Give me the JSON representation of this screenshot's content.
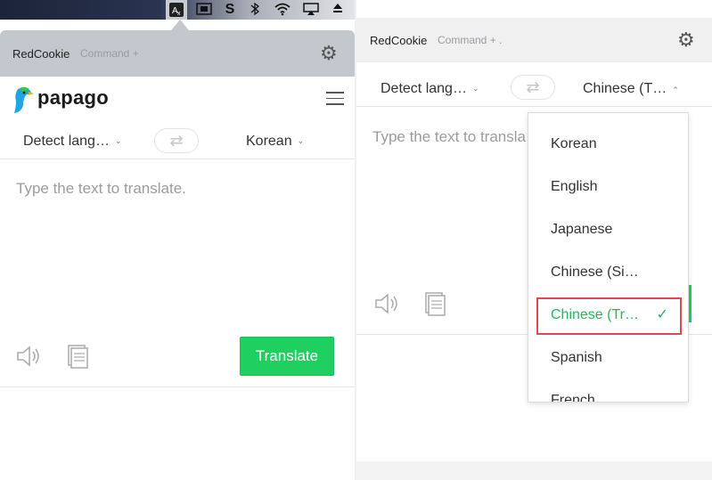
{
  "menubar": {
    "icons": [
      "translate-icon",
      "screenshot-icon",
      "s-app-icon",
      "bluetooth-icon",
      "wifi-icon",
      "airplay-icon",
      "eject-icon"
    ]
  },
  "left_panel": {
    "brand": "RedCookie",
    "shortcut": "Command +",
    "logo_text": "papago",
    "source_lang": "Detect lang…",
    "target_lang": "Korean",
    "placeholder": "Type the text to translate.",
    "translate_label": "Translate"
  },
  "right_panel": {
    "brand": "RedCookie",
    "shortcut": "Command + .",
    "source_lang": "Detect lang…",
    "target_lang": "Chinese (T…",
    "placeholder": "Type the text to transla",
    "dropdown": {
      "options": [
        "Korean",
        "English",
        "Japanese",
        "Chinese (Si…",
        "Chinese (Tr…",
        "Spanish",
        "French"
      ],
      "selected": "Chinese (Tr…"
    }
  },
  "colors": {
    "accent_green": "#1fd061",
    "highlight_red": "#e04a4a",
    "header_gray": "#c5c7ce"
  }
}
